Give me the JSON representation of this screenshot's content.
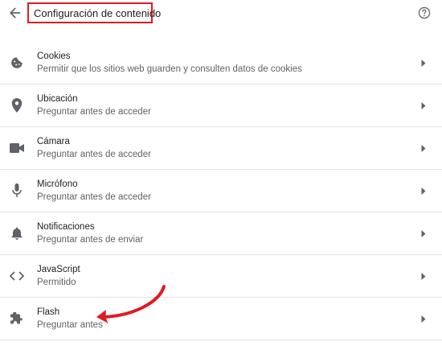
{
  "header": {
    "title": "Configuración de contenido",
    "back_icon": "arrow-left-icon",
    "help_icon": "help-circle-icon"
  },
  "settings": [
    {
      "label": "Cookies",
      "sublabel": "Permitir que los sitios web guarden y consulten datos de cookies",
      "icon": "cookie-icon"
    },
    {
      "label": "Ubicación",
      "sublabel": "Preguntar antes de acceder",
      "icon": "location-pin-icon"
    },
    {
      "label": "Cámara",
      "sublabel": "Preguntar antes de acceder",
      "icon": "camera-icon"
    },
    {
      "label": "Micrófono",
      "sublabel": "Preguntar antes de acceder",
      "icon": "microphone-icon"
    },
    {
      "label": "Notificaciones",
      "sublabel": "Preguntar antes de enviar",
      "icon": "bell-icon"
    },
    {
      "label": "JavaScript",
      "sublabel": "Permitido",
      "icon": "code-icon"
    },
    {
      "label": "Flash",
      "sublabel": "Preguntar antes",
      "icon": "puzzle-piece-icon"
    }
  ],
  "colors": {
    "highlight": "#e01b24",
    "icon": "#5f6368",
    "divider": "#e0e0e0"
  }
}
